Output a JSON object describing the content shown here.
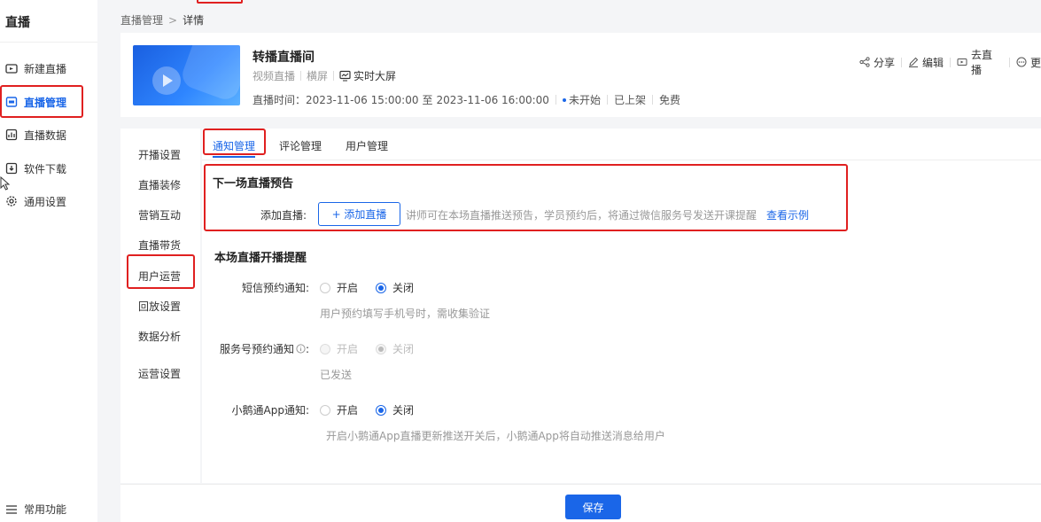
{
  "sidebar": {
    "title": "直播",
    "items": [
      {
        "label": "新建直播",
        "icon": "new-live-icon"
      },
      {
        "label": "直播管理",
        "icon": "live-manage-icon"
      },
      {
        "label": "直播数据",
        "icon": "live-data-icon"
      },
      {
        "label": "软件下载",
        "icon": "download-icon"
      },
      {
        "label": "通用设置",
        "icon": "gear-icon"
      }
    ],
    "bottom": {
      "label": "常用功能",
      "icon": "menu-icon"
    }
  },
  "breadcrumb": {
    "parent": "直播管理",
    "separator": ">",
    "current": "详情"
  },
  "header": {
    "title": "转播直播间",
    "type": "视频直播",
    "orientation": "横屏",
    "screen_label": "实时大屏",
    "time_label": "直播时间：",
    "time_start": "2023-11-06 15:00:00",
    "time_to": "至",
    "time_end": "2023-11-06 16:00:00",
    "status": "未开始",
    "shelf": "已上架",
    "price": "免费",
    "actions": {
      "share": "分享",
      "edit": "编辑",
      "go_live": "去直播",
      "more": "更"
    }
  },
  "submenu": {
    "items": [
      "开播设置",
      "直播装修",
      "营销互动",
      "直播带货",
      "用户运营",
      "回放设置",
      "数据分析",
      "运营设置"
    ]
  },
  "tabs": [
    "通知管理",
    "评论管理",
    "用户管理"
  ],
  "preview": {
    "title": "下一场直播预告",
    "add_label": "添加直播:",
    "add_button": "+ 添加直播",
    "hint": "讲师可在本场直播推送预告，学员预约后，将通过微信服务号发送开课提醒",
    "example_link": "查看示例"
  },
  "reminder": {
    "title": "本场直播开播提醒",
    "sms": {
      "label": "短信预约通知:",
      "on": "开启",
      "off": "关闭",
      "hint": "用户预约填写手机号时，需收集验证"
    },
    "service": {
      "label": "服务号预约通知",
      "colon": ":",
      "on": "开启",
      "off": "关闭",
      "hint": "已发送"
    },
    "app": {
      "label": "小鹅通App通知:",
      "on": "开启",
      "off": "关闭",
      "hint": "开启小鹅通App直播更新推送开关后，小鹅通App将自动推送消息给用户"
    }
  },
  "footer": {
    "save": "保存"
  },
  "colors": {
    "accent": "#1a66e8",
    "highlight": "#e02020"
  }
}
